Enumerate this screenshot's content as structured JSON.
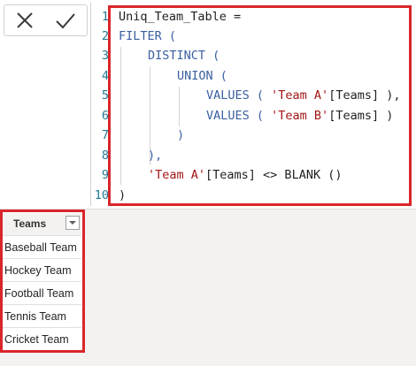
{
  "toolbar": {
    "cancel_icon": "close-icon",
    "commit_icon": "check-icon"
  },
  "editor": {
    "line_numbers": [
      "1",
      "2",
      "3",
      "4",
      "5",
      "6",
      "7",
      "8",
      "9",
      "10"
    ],
    "lines": [
      "Uniq_Team_Table =",
      "FILTER (",
      "DISTINCT (",
      "UNION (",
      "VALUES ( 'Team A'[Teams] ),",
      "VALUES ( 'Team B'[Teams] )",
      ")",
      "),",
      "'Team A'[Teams] <> BLANK ()",
      ")"
    ]
  },
  "table": {
    "column_header": "Teams",
    "rows": [
      "Baseball Team",
      "Hockey Team",
      "Football Team",
      "Tennis Team",
      "Cricket Team"
    ]
  },
  "colors": {
    "highlight": "#d9262b",
    "keyword": "#3a5fa0",
    "string": "#a31515",
    "line_number": "#237893"
  }
}
